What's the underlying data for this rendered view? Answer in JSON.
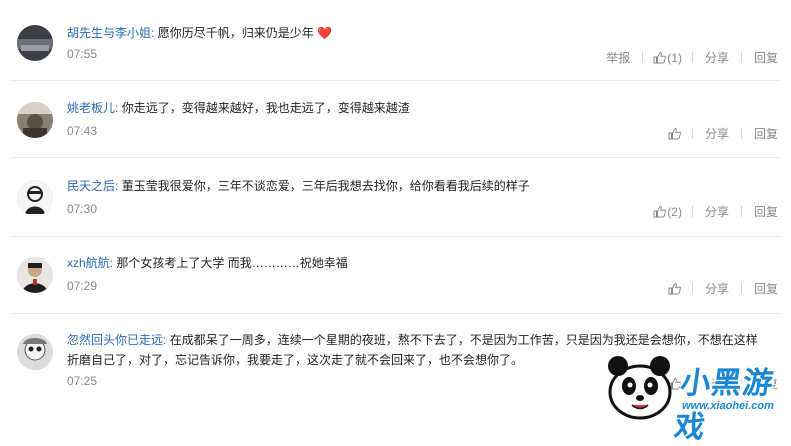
{
  "comments": [
    {
      "user": "胡先生与李小姐",
      "text": "愿你历尽千帆，归来仍是少年",
      "emoji": "❤️",
      "time": "07:55",
      "report": "举报",
      "likes": "(1)",
      "share": "分享",
      "reply": "回复"
    },
    {
      "user": "姚老板儿",
      "text": "你走远了，变得越来越好，我也走远了，变得越来越渣",
      "time": "07:43",
      "likes": "",
      "share": "分享",
      "reply": "回复"
    },
    {
      "user": "民天之后",
      "text": "董玉莹我很爱你，三年不谈恋爱，三年后我想去找你，给你看看我后续的样子",
      "time": "07:30",
      "likes": "(2)",
      "share": "分享",
      "reply": "回复"
    },
    {
      "user": "xzh航航",
      "text": "那个女孩考上了大学 而我…………祝她幸福",
      "time": "07:29",
      "likes": "",
      "share": "分享",
      "reply": "回复"
    },
    {
      "user": "忽然回头你已走远",
      "text": "在成都呆了一周多，连续一个星期的夜班，熬不下去了，不是因为工作苦，只是因为我还是会想你，不想在这样折磨自己了，对了，忘记告诉你，我要走了，这次走了就不会回来了，也不会想你了。",
      "time": "07:25",
      "likes": "",
      "share": "分享",
      "reply": "回复"
    }
  ],
  "watermark": {
    "title": "小黑游戏",
    "url": "www.xiaohei.com"
  }
}
